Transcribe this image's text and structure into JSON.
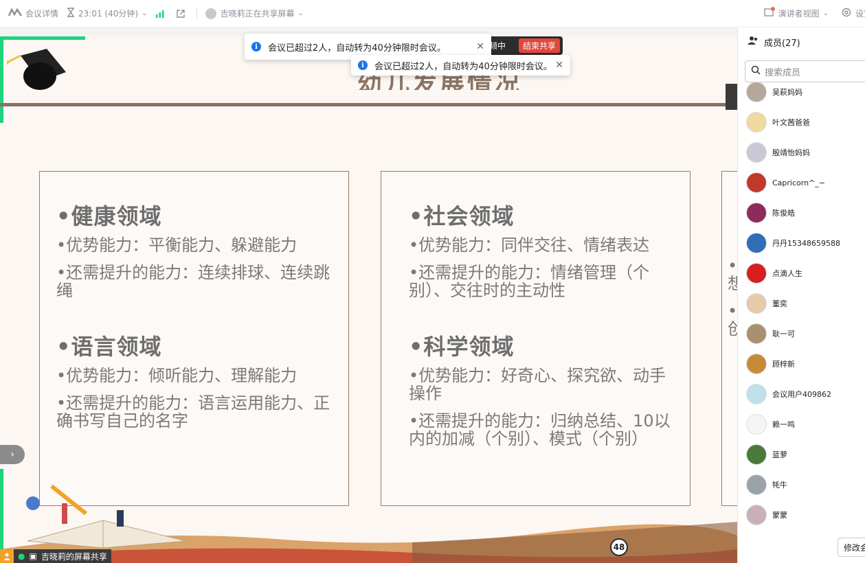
{
  "topbar": {
    "meeting_details": "会议详情",
    "timer": "23:01 (40分钟)",
    "sharing_status": "吉晓莉正在共享屏幕",
    "presenter_view": "演讲者视图",
    "settings": "设置"
  },
  "toasts": [
    {
      "text": "会议已超过2人，自动转为40分钟限时会议。"
    },
    {
      "text": "会议已超过2人，自动转为40分钟限时会议。"
    }
  ],
  "share_pill": {
    "status": "频中",
    "end_label": "结束共享"
  },
  "slide": {
    "title": "幼儿发展情况",
    "page_number": "48",
    "cards": [
      {
        "sections": [
          {
            "title": "•健康领域",
            "lines": [
              "•优势能力：平衡能力、躲避能力",
              "•还需提升的能力：连续排球、连续跳绳"
            ]
          },
          {
            "title": "•语言领域",
            "lines": [
              "•优势能力：倾听能力、理解能力",
              "•还需提升的能力：语言运用能力、正确书写自己的名字"
            ]
          }
        ]
      },
      {
        "sections": [
          {
            "title": "•社会领域",
            "lines": [
              "•优势能力：同伴交往、情绪表达",
              "•还需提升的能力：情绪管理（个别）、交往时的主动性"
            ]
          },
          {
            "title": "•科学领域",
            "lines": [
              "•优势能力：好奇心、探究欲、动手操作",
              "•还需提升的能力：归纳总结、10以内的加减（个别）、模式（个别）"
            ]
          }
        ]
      },
      {
        "partial_lines": [
          "•",
          "想",
          "•",
          "创"
        ]
      }
    ]
  },
  "panel": {
    "members_label": "成员(27)",
    "search_placeholder": "搜索成员",
    "members": [
      {
        "name": "吴萩妈妈",
        "color": "#b5a89a"
      },
      {
        "name": "叶文茜爸爸",
        "color": "#f0d9a0"
      },
      {
        "name": "殷靖怡妈妈",
        "color": "#c9c9d6"
      },
      {
        "name": "Capricorn^_−",
        "color": "#c0392b"
      },
      {
        "name": "陈俊皓",
        "color": "#8e2b5a"
      },
      {
        "name": "丹丹15348659588",
        "color": "#2e6fb7"
      },
      {
        "name": "点滴人生",
        "color": "#d62020"
      },
      {
        "name": "董奕",
        "color": "#e8c9a8"
      },
      {
        "name": "耿一可",
        "color": "#a89070"
      },
      {
        "name": "顾梓新",
        "color": "#c88a3a"
      },
      {
        "name": "会议用户409862",
        "color": "#bfe0ea"
      },
      {
        "name": "赖一鸣",
        "color": "#f5f5f5"
      },
      {
        "name": "蓝萝",
        "color": "#4a7a3a"
      },
      {
        "name": "牦牛",
        "color": "#9aa3a8"
      },
      {
        "name": "蒙蒙",
        "color": "#c8b0b8"
      }
    ],
    "modify_button": "修改会"
  },
  "bottom_bar": {
    "label": "吉晓莉的屏幕共享"
  },
  "colors": {
    "accent_green": "#1fd27c",
    "end_red": "#e0483e",
    "info_blue": "#1a73e8"
  }
}
